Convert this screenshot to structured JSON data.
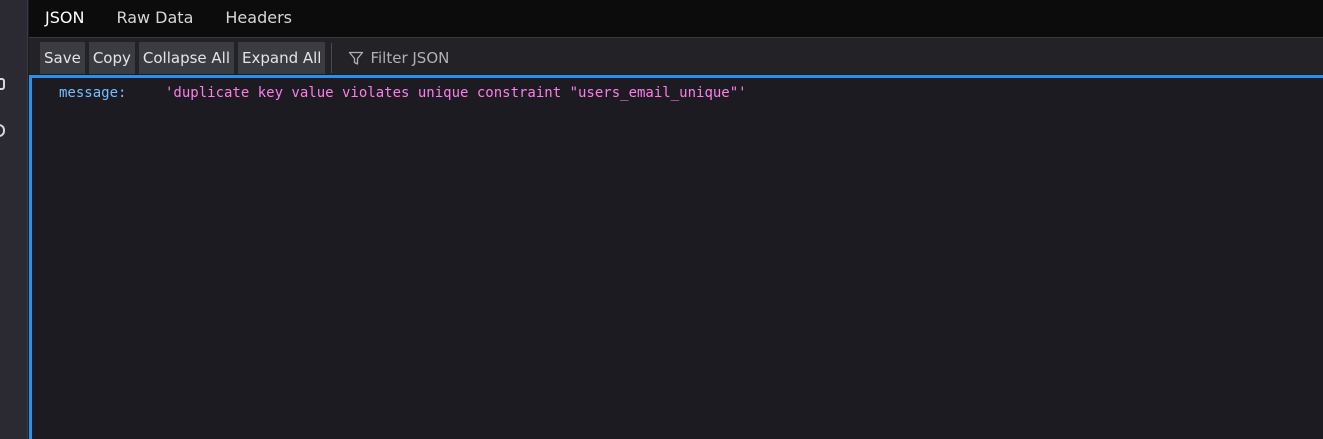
{
  "tabs": [
    {
      "label": "JSON",
      "selected": true
    },
    {
      "label": "Raw Data",
      "selected": false
    },
    {
      "label": "Headers",
      "selected": false
    }
  ],
  "toolbar": {
    "save_label": "Save",
    "copy_label": "Copy",
    "collapse_label": "Collapse All",
    "expand_label": "Expand All",
    "filter_placeholder": "Filter JSON",
    "filter_icon": "filter-icon"
  },
  "json_view": {
    "rows": [
      {
        "key": "message:",
        "value": "'duplicate key value violates unique constraint \"users_email_unique\"'"
      }
    ]
  },
  "colors": {
    "focus_border": "#2a90ef",
    "key": "#75bfff",
    "string_value": "#ff7de9",
    "background": "#1c1b22"
  }
}
